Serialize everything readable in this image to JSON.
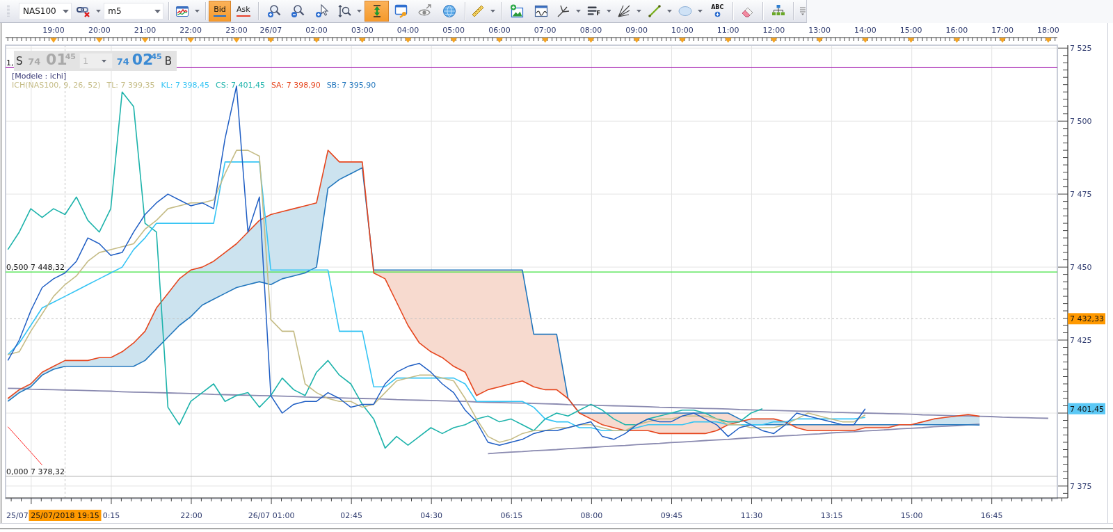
{
  "toolbar": {
    "items": [
      {
        "kind": "combo",
        "value": "NAS100"
      },
      {
        "kind": "tool",
        "selected": false,
        "menu": true
      },
      {
        "kind": "combo",
        "value": "m5"
      },
      {
        "kind": "separator"
      },
      {
        "kind": "tool",
        "selected": false,
        "menu": true
      },
      {
        "kind": "separator"
      },
      {
        "kind": "toggle",
        "label": "Bid",
        "selected": true,
        "color": "#1e6fd0"
      },
      {
        "kind": "toggle",
        "label": "Ask",
        "selected": false,
        "color": "#e8402a"
      },
      {
        "kind": "separator"
      },
      {
        "kind": "tool",
        "selected": false,
        "menu": false
      },
      {
        "kind": "tool",
        "selected": false,
        "menu": false
      },
      {
        "kind": "tool",
        "selected": false,
        "menu": false
      },
      {
        "kind": "tool",
        "selected": false,
        "menu": true
      },
      {
        "kind": "tool",
        "selected": true,
        "menu": false
      },
      {
        "kind": "tool",
        "selected": false,
        "menu": false
      },
      {
        "kind": "tool",
        "selected": false,
        "menu": false
      },
      {
        "kind": "tool",
        "selected": false,
        "menu": false
      },
      {
        "kind": "separator"
      },
      {
        "kind": "tool",
        "selected": false,
        "menu": true
      },
      {
        "kind": "separator"
      },
      {
        "kind": "tool",
        "selected": false,
        "menu": false
      },
      {
        "kind": "tool",
        "selected": false,
        "menu": false
      },
      {
        "kind": "tool",
        "selected": false,
        "menu": true
      },
      {
        "kind": "tool",
        "label": "F",
        "selected": false,
        "menu": true
      },
      {
        "kind": "tool",
        "selected": false,
        "menu": true
      },
      {
        "kind": "tool",
        "selected": false,
        "menu": true
      },
      {
        "kind": "tool",
        "selected": false,
        "menu": true
      },
      {
        "kind": "tool",
        "label": "ABC",
        "selected": false,
        "menu": false
      },
      {
        "kind": "separator"
      },
      {
        "kind": "tool",
        "selected": false,
        "menu": false
      },
      {
        "kind": "separator"
      },
      {
        "kind": "tool",
        "selected": false,
        "menu": false
      },
      {
        "kind": "separator"
      }
    ]
  },
  "chart": {
    "trade_panel": {
      "sides": [
        {
          "kind": "sell",
          "label": "S",
          "figure_small": "74",
          "figure_big": "01",
          "figure_sup": "45"
        },
        {
          "kind": "buy",
          "label": "B",
          "figure_small": "74",
          "figure_big": "02",
          "figure_sup": "45"
        }
      ],
      "quantity": "1"
    },
    "legend": {
      "model": "[Modele : ichi]",
      "indicator": {
        "label": "ICH(NAS100, 9, 26, 52)",
        "color": "#c5bc86"
      }
    },
    "level_label_fragment": "1,",
    "crosshair_time_label": "25/07/2018 19:15",
    "bottom_axis_labels": [
      "25/07",
      "0:15",
      "22:00",
      "26/07 01:00",
      "02:45",
      "04:30",
      "06:15",
      "08:00",
      "09:45",
      "11:30",
      "13:15",
      "15:00",
      "16:45"
    ],
    "chart_data": {
      "type": "line",
      "grid": true,
      "ylim": [
        7370.7,
        7526
      ],
      "categories": [
        null,
        null,
        null,
        null,
        "19:00",
        null,
        null,
        null,
        "20:00",
        null,
        null,
        null,
        "21:00",
        null,
        null,
        null,
        "22:00",
        null,
        null,
        null,
        "23:00",
        null,
        null,
        "26/07",
        null,
        null,
        null,
        "02:00",
        null,
        null,
        null,
        "03:00",
        null,
        null,
        null,
        "04:00",
        null,
        null,
        null,
        "05:00",
        null,
        null,
        null,
        "06:00",
        null,
        null,
        null,
        "07:00",
        null,
        null,
        null,
        "08:00",
        null,
        null,
        null,
        "09:00",
        null,
        null,
        null,
        "10:00",
        null,
        null,
        null,
        "11:00",
        null,
        null,
        null,
        "12:00",
        null,
        null,
        null,
        "13:00",
        null,
        null,
        null,
        "14:00",
        null,
        null,
        null,
        "15:00",
        null,
        null,
        null,
        "16:00",
        null,
        null,
        null,
        "17:00",
        null,
        null,
        null,
        "18:00"
      ],
      "yticks": [
        {
          "value": 7375,
          "label": "7 375"
        },
        {
          "value": 7425,
          "label": "7 425"
        },
        {
          "value": 7450,
          "label": "7 450"
        },
        {
          "value": 7475,
          "label": "7 475"
        },
        {
          "value": 7500,
          "label": "7 500"
        },
        {
          "value": 7525,
          "label": "7 525"
        }
      ],
      "series": [
        {
          "color": "#1f5ec4",
          "values": [
            7418,
            7425,
            7435,
            7443,
            7446,
            7448,
            7452,
            7460,
            7458,
            7454,
            7455,
            7462,
            7468,
            7472,
            7475,
            7473,
            7471,
            7472,
            7470,
            7494,
            7512,
            7462,
            7474,
            7406,
            7400,
            7403,
            7404,
            7404,
            7407,
            7405,
            7402,
            7403,
            7403,
            7410,
            7414,
            7416,
            7417,
            7414,
            7410,
            7407,
            7401,
            7397,
            7390,
            7389,
            7390,
            7391,
            7393,
            7394,
            7394,
            7395,
            7396,
            7397,
            7392,
            7391,
            7393,
            7396,
            7398,
            7397,
            7397,
            7399,
            7400,
            7398,
            7396,
            7392,
            7395,
            7396,
            7394,
            7393,
            7396,
            7400,
            7399,
            7398,
            7397,
            7396,
            7396,
            7401.5,
            null,
            null,
            null,
            null,
            null,
            null,
            null,
            null,
            null,
            null,
            null,
            null,
            null,
            null,
            null,
            null
          ]
        },
        {
          "name": "TL: 7 399,35",
          "color": "#c5bc86",
          "values": [
            7420,
            7421,
            7428,
            7434,
            7440,
            7444,
            7447,
            7452,
            7455,
            7456,
            7457,
            7458,
            7463,
            7466,
            7470,
            7471,
            7472,
            7472,
            7473,
            7482,
            7490,
            7490,
            7488,
            7432,
            7428,
            7428,
            7410,
            7407,
            7405,
            7404,
            7404,
            7402,
            7403,
            7407,
            7411,
            7412,
            7413,
            7413,
            7412,
            7411,
            7405,
            7398,
            7392,
            7390,
            7391,
            7393,
            7394,
            7394,
            7395,
            7395,
            7396,
            7396,
            7395,
            7394,
            7394,
            7396,
            7397,
            7398,
            7398,
            7399,
            7399,
            7399,
            7398,
            7396,
            7396,
            7395,
            7395,
            7395,
            7396,
            7398,
            7400,
            7399,
            7398,
            7397,
            7397,
            7399.4,
            null,
            null,
            null,
            null,
            null,
            null,
            null,
            null,
            null,
            null,
            null,
            null,
            null,
            null,
            null,
            null
          ]
        },
        {
          "name": "KL: 7 398,45",
          "color": "#35c4f4",
          "values": [
            7420,
            7424,
            7430,
            7436,
            7438,
            7440,
            7442,
            7444,
            7446,
            7448,
            7450,
            7456,
            7460,
            7465,
            7465,
            7465,
            7465,
            7465,
            7465,
            7486,
            7486,
            7486,
            7486,
            7449,
            7449,
            7449,
            7449,
            7449,
            7449,
            7428,
            7428,
            7428,
            7409,
            7409,
            7412,
            7412,
            7412,
            7412,
            7412,
            7412,
            7410,
            7404,
            7404,
            7404,
            7404,
            7404,
            7402,
            7398,
            7397,
            7397,
            7395,
            7395,
            7394,
            7394,
            7394,
            7395,
            7396,
            7396,
            7396,
            7396,
            7397,
            7397,
            7397,
            7396,
            7396,
            7396,
            7396,
            7397,
            7397,
            7398,
            7398,
            7398,
            7398,
            7398,
            7398,
            7398.5,
            null,
            null,
            null,
            null,
            null,
            null,
            null,
            null,
            null,
            null,
            null,
            null,
            null,
            null,
            null,
            null
          ]
        },
        {
          "name": "CS: 7 401,45",
          "color": "#1db3ab",
          "values": [
            7456,
            7462,
            7470,
            7467,
            7470,
            7468,
            7474,
            7466,
            7462,
            7470,
            7510,
            7505,
            7465,
            7462,
            7402,
            7396,
            7404,
            7407,
            7410,
            7404,
            7406,
            7407,
            7402,
            7406,
            7412,
            7408,
            7406,
            7414,
            7418,
            7413,
            7410,
            7403,
            7398,
            7388,
            7392,
            7389,
            7392,
            7395,
            7393,
            7395,
            7396,
            7398,
            7399,
            7397,
            7398,
            7396,
            7394,
            7398,
            7400,
            7399,
            7401,
            7403,
            7401,
            7398,
            7396,
            7396,
            7398,
            7399,
            7400,
            7401,
            7401,
            7400,
            7398,
            7397,
            7397,
            7400,
            7401.5,
            null,
            null,
            null,
            null,
            null,
            null,
            null,
            null,
            null,
            null,
            null,
            null,
            null,
            null,
            null,
            null,
            null,
            null,
            null,
            null,
            null,
            null,
            null,
            null,
            null
          ]
        },
        {
          "name": "SA: 7 398,90",
          "color": "#e6461e",
          "values": [
            7405,
            7408,
            7410,
            7414,
            7416,
            7418,
            7418,
            7418,
            7419,
            7419,
            7421,
            7424,
            7428,
            7436,
            7441,
            7446,
            7449,
            7450,
            7452,
            7455,
            7458,
            7462,
            7466,
            7468,
            7469,
            7470,
            7471,
            7472,
            7490,
            7486,
            7486,
            7486,
            7448,
            7446,
            7438,
            7430,
            7424,
            7421,
            7419,
            7416,
            7414,
            7406,
            7408,
            7409,
            7410,
            7411,
            7409,
            7408,
            7408,
            7405,
            7400,
            7398,
            7396,
            7395,
            7394,
            7394,
            7394,
            7393,
            7393,
            7393,
            7393,
            7393,
            7394,
            7396,
            7397,
            7398,
            7398,
            7398,
            7397,
            7395,
            7394,
            7394,
            7394,
            7394,
            7394,
            7395,
            7395,
            7395,
            7396,
            7396,
            7397,
            7398,
            7398.5,
            7399,
            7399.5,
            7398.9,
            null,
            null,
            null,
            null,
            null,
            null
          ]
        },
        {
          "name": "SB: 7 395,90",
          "color": "#2176bd",
          "values": [
            7404,
            7407,
            7409,
            7413,
            7415,
            7416,
            7416,
            7416,
            7416,
            7416,
            7416,
            7416,
            7418,
            7422,
            7426,
            7430,
            7433,
            7437,
            7439,
            7441,
            7443,
            7444,
            7445,
            7444,
            7446,
            7447,
            7448,
            7450,
            7477,
            7480,
            7482,
            7484,
            7449,
            7449,
            7449,
            7449,
            7449,
            7449,
            7449,
            7449,
            7449,
            7449,
            7449,
            7449,
            7449,
            7449,
            7427,
            7427,
            7427,
            7405,
            7400,
            7400,
            7400,
            7400,
            7400,
            7400,
            7400,
            7400,
            7400,
            7400,
            7400,
            7400,
            7400,
            7400,
            7398,
            7396,
            7396,
            7396,
            7396,
            7396,
            7396,
            7396,
            7396,
            7396,
            7396,
            7396,
            7396,
            7396,
            7396,
            7396,
            7396,
            7396,
            7396,
            7396,
            7396,
            7395.9,
            null,
            null,
            null,
            null,
            null,
            null
          ]
        },
        {
          "color": "#8a8ab0",
          "values": [
            7408.5,
            7408.4,
            7408.2,
            7408.1,
            7408.0,
            7407.9,
            7407.8,
            7407.7,
            7407.6,
            7407.5,
            7407.3,
            7407.2,
            7407.1,
            7407.0,
            7406.9,
            7406.8,
            7406.7,
            7406.6,
            7406.4,
            7406.3,
            7406.2,
            7406.1,
            7406.0,
            7405.9,
            7405.8,
            7405.7,
            7405.5,
            7405.4,
            7405.3,
            7405.2,
            7405.1,
            7405.0,
            7404.9,
            7404.8,
            7404.6,
            7404.5,
            7404.4,
            7404.3,
            7404.2,
            7404.1,
            7404.0,
            7403.8,
            7403.7,
            7403.6,
            7403.5,
            7403.4,
            7403.3,
            7403.2,
            7403.1,
            7402.9,
            7402.8,
            7402.7,
            7402.6,
            7402.5,
            7402.4,
            7402.3,
            7402.2,
            7402.0,
            7401.9,
            7401.8,
            7401.7,
            7401.6,
            7401.5,
            7401.4,
            7401.2,
            7401.1,
            7401.0,
            7400.9,
            7400.8,
            7400.7,
            7400.6,
            7400.5,
            7400.3,
            7400.2,
            7400.1,
            7400.0,
            7399.9,
            7399.8,
            7399.7,
            7399.6,
            7399.4,
            7399.3,
            7399.2,
            7399.1,
            7399.0,
            7398.9,
            7398.8,
            7398.6,
            7398.5,
            7398.4,
            7398.3,
            7398.2
          ]
        },
        {
          "color": "#8a8ab0",
          "values": [
            null,
            null,
            null,
            null,
            null,
            null,
            null,
            null,
            null,
            null,
            null,
            null,
            null,
            null,
            null,
            null,
            null,
            null,
            null,
            null,
            null,
            null,
            null,
            null,
            null,
            null,
            null,
            null,
            null,
            null,
            null,
            null,
            null,
            null,
            null,
            null,
            null,
            null,
            null,
            null,
            null,
            null,
            7386.1,
            7386.4,
            7386.6,
            7386.8,
            7387.1,
            7387.3,
            7387.5,
            7387.8,
            7388.0,
            7388.2,
            7388.5,
            7388.7,
            7388.9,
            7389.2,
            7389.4,
            7389.6,
            7389.9,
            7390.1,
            7390.3,
            7390.6,
            7390.8,
            7391.0,
            7391.3,
            7391.5,
            7391.8,
            7392.0,
            7392.2,
            7392.4,
            7392.7,
            7392.9,
            7393.2,
            7393.4,
            7393.6,
            7393.9,
            7394.1,
            7394.3,
            7394.6,
            7394.8,
            7395.0,
            7395.3,
            7395.5,
            7395.7,
            7396.0,
            7396.2,
            null,
            null,
            null,
            null,
            null,
            null
          ]
        },
        {
          "color": "#ff2a2a",
          "values": [
            7395.3,
            7391.0,
            7386.6,
            7382.2,
            null,
            null,
            null,
            null,
            null,
            null,
            null,
            null,
            null,
            null,
            null,
            null,
            null,
            null,
            null,
            null,
            null,
            null,
            null,
            null,
            null,
            null,
            null,
            null,
            null,
            null,
            null,
            null,
            null,
            null,
            null,
            null,
            null,
            null,
            null,
            null,
            null,
            null,
            null,
            null,
            null,
            null,
            null,
            null,
            null,
            null,
            null,
            null,
            null,
            null,
            null,
            null,
            null,
            null,
            null,
            null,
            null,
            null,
            null,
            null,
            null,
            null,
            null,
            null,
            null,
            null,
            null,
            null,
            null,
            null,
            null,
            null,
            null,
            null,
            null,
            null,
            null,
            null,
            null,
            null,
            null,
            null,
            null,
            null,
            null,
            null,
            null,
            null
          ]
        }
      ],
      "ref_lines": [
        {
          "axis": "y",
          "value": 7518.31,
          "color": "#a21caf"
        },
        {
          "axis": "y",
          "value": 7448.32,
          "label": "0,500 7 448,32",
          "color": "#3ee23e"
        },
        {
          "axis": "y",
          "value": 7378.32,
          "label": "0,000 7 378,32",
          "color": "#b4b4b4"
        },
        {
          "axis": "y",
          "value": 7432.33,
          "label": "7 432,33"
        }
      ],
      "annotations": [
        "7 401,45"
      ]
    }
  }
}
